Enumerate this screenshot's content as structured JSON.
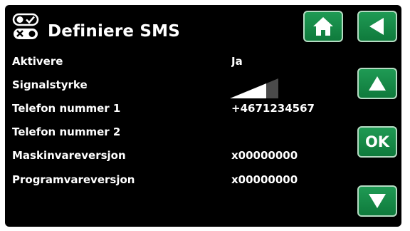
{
  "header": {
    "title": "Definiere SMS",
    "icon": "sms-toggle-icon"
  },
  "buttons": {
    "home": "home-icon",
    "back": "back-arrow-icon",
    "up": "up-arrow-icon",
    "ok_label": "OK",
    "down": "down-arrow-icon"
  },
  "rows": [
    {
      "label": "Aktivere",
      "value": "Ja"
    },
    {
      "label": "Signalstyrke",
      "value": null
    },
    {
      "label": "Telefon nummer 1",
      "value": "+4671234567"
    },
    {
      "label": "Telefon nummer 2",
      "value": ""
    },
    {
      "label": "Maskinvareversjon",
      "value": "x00000000"
    },
    {
      "label": "Programvareversjon",
      "value": "x00000000"
    }
  ],
  "signal_strength": {
    "filled_bars": 3,
    "total_bars": 4
  },
  "colors": {
    "accent": "#1f9a54",
    "background": "#000000",
    "text": "#ffffff"
  }
}
